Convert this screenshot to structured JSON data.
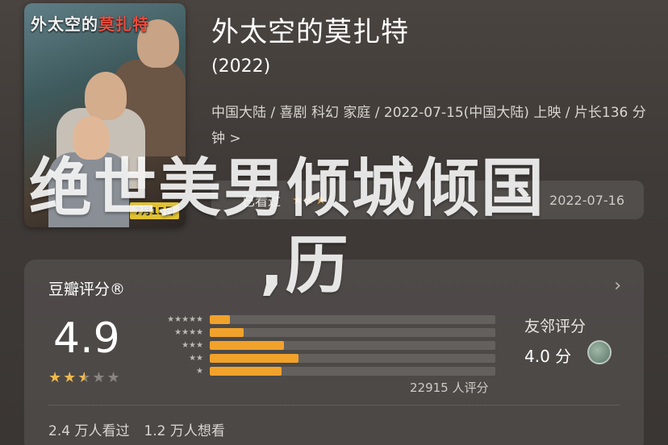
{
  "poster": {
    "title_prefix": "外太空的",
    "title_highlight": "莫扎特",
    "date_badge": "7月15日"
  },
  "movie": {
    "title": "外太空的莫扎特",
    "year": "(2022)",
    "meta": "中国大陆 / 喜剧 科幻 家庭 / 2022-07-15(中国大陆) 上映 / 片长136 分钟",
    "meta_chevron": ">"
  },
  "my_record": {
    "label": "已看过",
    "stars": "★★★",
    "date": "2022-07-16"
  },
  "overlay": {
    "line1": "绝世美男倾城倾国",
    "line2": ",历"
  },
  "rating": {
    "title": "豆瓣评分®",
    "arrow": "›",
    "score": "4.9",
    "score_value": 4.9,
    "stars_on": "★★",
    "stars_half": "★",
    "stars_off": "★★",
    "breakdown": [
      {
        "stars": "★★★★★",
        "percent": 0.07
      },
      {
        "stars": "★★★★",
        "percent": 0.12
      },
      {
        "stars": "★★★",
        "percent": 0.26
      },
      {
        "stars": "★★",
        "percent": 0.31
      },
      {
        "stars": "★",
        "percent": 0.25
      }
    ],
    "count": "22915 人评分",
    "friend_label": "友邻评分",
    "friend_score": "4.0 分"
  },
  "stats": {
    "watched": "2.4 万人看过",
    "wish": "1.2 万人想看"
  },
  "colors": {
    "accent": "#f1a22a",
    "star": "#f1b84a",
    "background": "#433e3b"
  }
}
